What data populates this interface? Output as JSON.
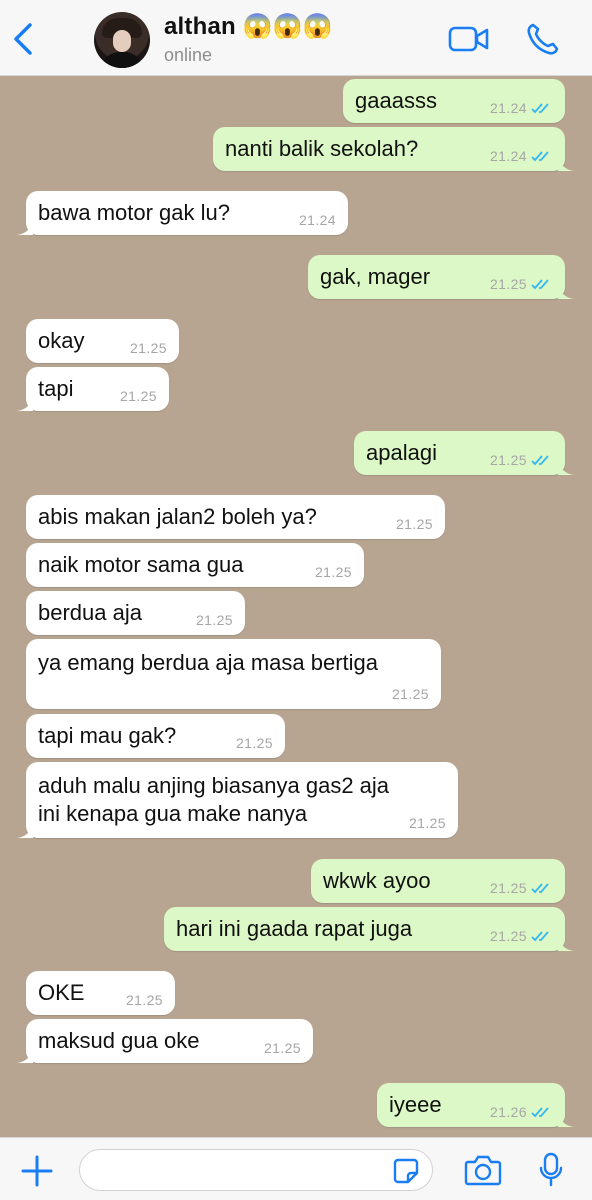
{
  "header": {
    "contact_name": "althan 😱😱😱",
    "status": "online",
    "accent_color": "#1a7ef2"
  },
  "messages": [
    {
      "text": "gaaasss",
      "time": "21.24",
      "direction": "out",
      "read": true
    },
    {
      "text": "nanti balik sekolah?",
      "time": "21.24",
      "direction": "out",
      "read": true
    },
    {
      "text": "bawa motor gak lu?",
      "time": "21.24",
      "direction": "in"
    },
    {
      "text": "gak, mager",
      "time": "21.25",
      "direction": "out",
      "read": true
    },
    {
      "text": "okay",
      "time": "21.25",
      "direction": "in"
    },
    {
      "text": "tapi",
      "time": "21.25",
      "direction": "in"
    },
    {
      "text": "apalagi",
      "time": "21.25",
      "direction": "out",
      "read": true
    },
    {
      "text": "abis makan jalan2 boleh ya?",
      "time": "21.25",
      "direction": "in"
    },
    {
      "text": "naik motor sama gua",
      "time": "21.25",
      "direction": "in"
    },
    {
      "text": "berdua aja",
      "time": "21.25",
      "direction": "in"
    },
    {
      "text": "ya emang berdua aja masa bertiga",
      "time": "21.25",
      "direction": "in"
    },
    {
      "text": "tapi mau gak?",
      "time": "21.25",
      "direction": "in"
    },
    {
      "text": "aduh malu anjing biasanya gas2 aja ini kenapa gua make nanya",
      "time": "21.25",
      "direction": "in"
    },
    {
      "text": "wkwk ayoo",
      "time": "21.25",
      "direction": "out",
      "read": true
    },
    {
      "text": "hari ini gaada rapat juga",
      "time": "21.25",
      "direction": "out",
      "read": true
    },
    {
      "text": "OKE",
      "time": "21.25",
      "direction": "in"
    },
    {
      "text": "maksud gua oke",
      "time": "21.25",
      "direction": "in"
    },
    {
      "text": "iyeee",
      "time": "21.26",
      "direction": "out",
      "read": true
    }
  ],
  "composer": {
    "input_value": "",
    "icons": [
      "plus-icon",
      "sticker-icon",
      "camera-icon",
      "microphone-icon"
    ]
  },
  "colors": {
    "wallpaper": "#b7a592",
    "outgoing_bubble": "#dcf8c6",
    "incoming_bubble": "#ffffff",
    "read_ticks": "#34b7f1"
  }
}
